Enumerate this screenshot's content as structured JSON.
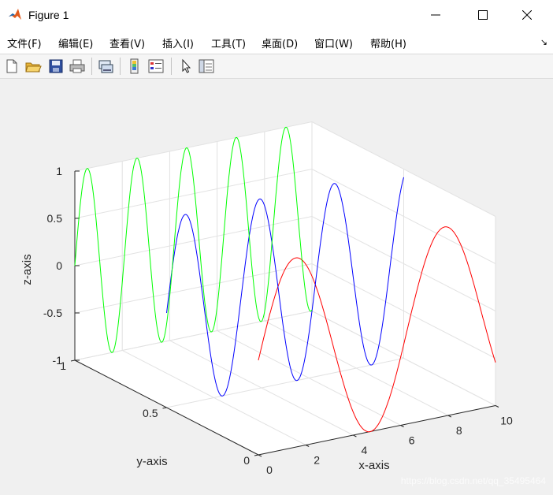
{
  "window": {
    "title": "Figure 1",
    "controls": {
      "minimize": "—",
      "maximize": "☐",
      "close": "✕"
    }
  },
  "menu": {
    "items": [
      "文件(F)",
      "编辑(E)",
      "查看(V)",
      "插入(I)",
      "工具(T)",
      "桌面(D)",
      "窗口(W)",
      "帮助(H)"
    ],
    "dock_glyph": "↘"
  },
  "toolbar": {
    "buttons": [
      "new-figure-icon",
      "open-file-icon",
      "save-icon",
      "print-icon",
      "link-plot-icon",
      "colorbar-icon",
      "legend-icon",
      "edit-plot-pointer-icon",
      "property-inspector-icon"
    ]
  },
  "chart_data": {
    "type": "line",
    "projection": "3d",
    "xlabel": "x-axis",
    "ylabel": "y-axis",
    "zlabel": "z-axis",
    "xlim": [
      0,
      10
    ],
    "ylim": [
      0,
      1
    ],
    "zlim": [
      -1,
      1
    ],
    "xticks": [
      "0",
      "2",
      "4",
      "6",
      "8",
      "10"
    ],
    "yticks": [
      "0",
      "0.5",
      "1"
    ],
    "zticks": [
      "-1",
      "-0.5",
      "0",
      "0.5",
      "1"
    ],
    "grid": true,
    "series": [
      {
        "color": "#ff0000",
        "y": 0,
        "z_function": "sin(x)",
        "x_range": [
          0,
          10
        ]
      },
      {
        "color": "#0000ff",
        "y": 0.5,
        "z_function": "sin(2x)",
        "x_range": [
          0,
          10
        ]
      },
      {
        "color": "#00ff00",
        "y": 1,
        "z_function": "sin(3x)",
        "x_range": [
          0,
          10
        ]
      }
    ]
  },
  "watermark": "https://blog.csdn.net/qq_35495464"
}
